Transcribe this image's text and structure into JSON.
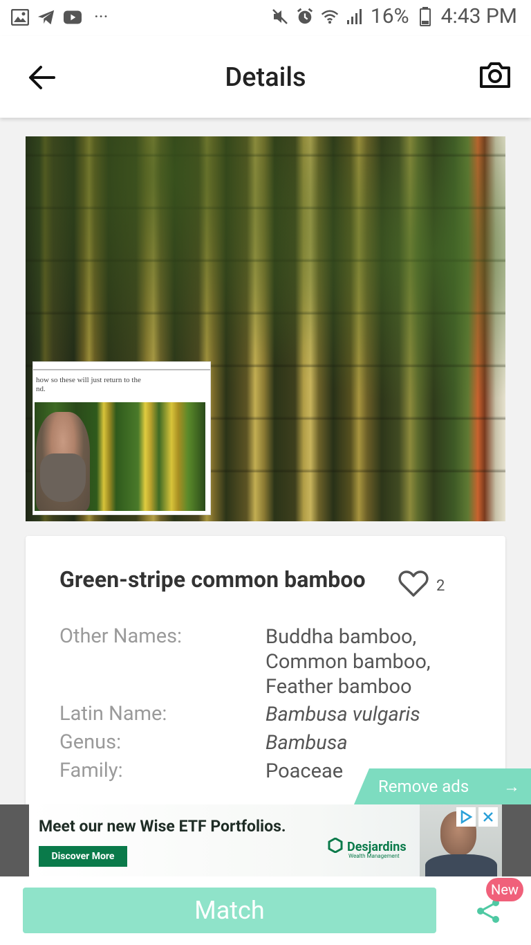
{
  "status_bar": {
    "battery": "16%",
    "time": "4:43 PM",
    "overflow": "···",
    "icons": [
      "image-icon",
      "telegram-icon",
      "youtube-icon",
      "mute-icon",
      "alarm-icon",
      "wifi-icon",
      "signal-icon",
      "battery-icon"
    ]
  },
  "app_bar": {
    "title": "Details",
    "back_icon": "arrow-left-icon",
    "camera_icon": "camera-icon"
  },
  "hero": {
    "inset_text_line1": "how so these will just return to the",
    "inset_text_line2": "nd."
  },
  "plant": {
    "name": "Green-stripe common bamboo",
    "likes": "2",
    "rows": [
      {
        "label": "Other Names:",
        "values": [
          "Buddha bamboo,",
          "Common bamboo,",
          "Feather bamboo"
        ],
        "italic": false
      },
      {
        "label": "Latin Name:",
        "values": [
          "Bambusa vulgaris"
        ],
        "italic": true
      },
      {
        "label": "Genus:",
        "values": [
          "Bambusa"
        ],
        "italic": true
      },
      {
        "label": "Family:",
        "values": [
          "Poaceae"
        ],
        "italic": false
      }
    ]
  },
  "remove_ads": {
    "label": "Remove ads",
    "arrow": "→"
  },
  "ad": {
    "headline": "Meet our new Wise ETF Portfolios.",
    "cta": "Discover More",
    "brand": "Desjardins",
    "brand_sub": "Wealth Management"
  },
  "bottom": {
    "match_label": "Match",
    "new_badge": "New"
  },
  "colors": {
    "accent": "#8fe3c9",
    "remove_ads_bg": "#7ddcc0",
    "badge": "#f0607a",
    "share_icon": "#4fc9a3"
  }
}
